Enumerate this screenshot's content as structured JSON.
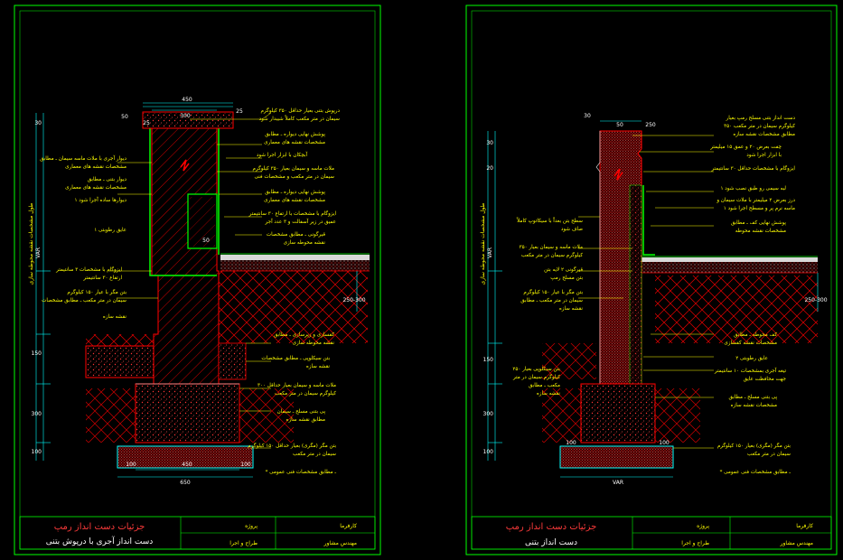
{
  "colors": {
    "background": "#000000",
    "frame": "#00ff00",
    "structure": "#ff0000",
    "dimension": "#00ffff",
    "annotation": "#ffff00",
    "label": "#ffffff",
    "title": "#ff3b3b"
  },
  "sheet_left": {
    "title_block": {
      "main_title": "جزئیات دست انداز رمپ",
      "subtitle": "دست انداز آجری با درپوش بتنی",
      "field_1": "پروژه",
      "field_2": "کارفرما",
      "field_3": "طراح و اجرا",
      "field_4": "مهندس مشاور"
    },
    "dimensions_top": [
      "450",
      "25",
      "300",
      "25",
      "50",
      "50"
    ],
    "dimensions_left": [
      "30",
      "VAR",
      "150",
      "300",
      "100"
    ],
    "dimensions_bottom": [
      "100",
      "450",
      "100",
      "650"
    ],
    "dimensions_right": [
      "250-300"
    ],
    "labels_right": [
      "درپوش بتنی بعیار حداقل ۳۵۰ کیلوگرم",
      "سیمان در متر مکعب کاملاً شیبدار شود",
      "پوشش نهایی دیواره ـ مطابق",
      "مشخصات نقشه های معماری",
      "آبچکان با ابزار اجرا شود",
      "ملات ماسه و سیمان بعیار ۳۵۰ کیلوگرم",
      "سیمان در متر مکعب و مشخصات فنی",
      "پوشش نهایی دیواره ـ مطابق",
      "مشخصات نقشه های معماری",
      "ایزوگام با مشخصات با ارتفاع ۳۰ سانتیمتر",
      "عمیق در زیر آسفالت و ۳ عدد آجر",
      "قیرگونی ـ مطابق مشخصات",
      "نقشه محوطه سازی"
    ],
    "labels_left": [
      "دیوار آجری با ملات ماسه سیمان ـ مطابق",
      "مشخصات نقشه های معماری",
      "دیوار بتنی ـ مطابق",
      "مشخصات نقشه های معماری",
      "دیوارها ساده آجرا شود ۱",
      "عایق رطوبتی ۱",
      "ایزوگام با مشخصات ۳ سانتیمتر",
      "ارتفاع ۳۰ سانتیمتر",
      "بتن مگر با عیار ۱۵۰ کیلوگرم",
      "سیمان در متر مکعب ـ مطابق مشخصات",
      "نقشه سازه"
    ],
    "labels_right_lower": [
      "کفسازی و زیرسازی ـ مطابق",
      "نقشه محوطه سازی",
      "بتن سیکلوپی ـ مطابق مشخصات",
      "نقشه سازه",
      "ملات ماسه و سیمان بعیار حداقل ۳۰۰",
      "کیلوگرم سیمان در متر مکعب",
      "پی بتنی مسلح ـ سیمان",
      "مطابق نقشه سازه",
      "بتن مگر (مگری) بعیار حداقل ۱۵۰ کیلوگرم",
      "سیمان در متر مکعب",
      "* ـ مطابق مشخصات فنی عمومی"
    ],
    "vertical_label": "طول مشخصات نقشه محوطه سازی"
  },
  "sheet_right": {
    "title_block": {
      "main_title": "جزئیات دست انداز رمپ",
      "subtitle": "دست انداز بتنی",
      "field_1": "پروژه",
      "field_2": "کارفرما",
      "field_3": "طراح و اجرا",
      "field_4": "مهندس مشاور"
    },
    "dimensions_top": [
      "30",
      "50",
      "250"
    ],
    "dimensions_left": [
      "30",
      "20",
      "VAR",
      "150",
      "300",
      "100"
    ],
    "dimensions_bottom": [
      "100",
      "VAR",
      "100"
    ],
    "dimensions_right": [
      "250-300"
    ],
    "labels_right": [
      "دست انداز بتنی مسلح رمپ بعیار",
      "۳۵۰ کیلوگرم سیمان در متر مکعب",
      "مطابق مشخصات نقشه سازه",
      "چفت بعرض ۲۰ و عمق ۱۵ میلیمتر",
      "با ابزار اجرا شود",
      "ایزوگام با مشخصات حداقل ۳۰ سانتیمتر",
      "لبه سیمی رو طبق نصب شود ۱",
      "درز بعرض ۲ میلیمتر با ملات سیمان و",
      "ماسه نرم پر و مسطح اجرا شود ۱",
      "پوشش نهایی کف ـ مطابق",
      "مشخصات نقشه محوطه"
    ],
    "labels_left": [
      "سطح بتن بعداً با سیکاتوپ کاملاً",
      "صاف شود",
      "ملات ماسه و سیمان بعیار ۳۵۰",
      "کیلوگرم سیمان در متر مکعب",
      "قیرگونی ۲ لایه بتن",
      "بتن مسلح رمپ",
      "بتن مگر با عیار ۱۵۰ کیلوگرم",
      "سیمان در متر مکعب ـ مطابق",
      "نقشه سازه",
      "بتن سیکلوپی بعیار ۲۵۰",
      "کیلوگرم سیمان در متر",
      "مکعب ـ مطابق",
      "نقشه سازه"
    ],
    "labels_right_lower": [
      "کف محوطه ـ مطابق",
      "مشخصات نقشه کفسازی",
      "عایق رطوبتی ۲",
      "تیغه آجری بمشخصات ۱۰ سانتیمتر",
      "جهت محافظت عایق",
      "پی بتنی مسلح ـ مطابق",
      "مشخصات نقشه سازه",
      "بتن مگر (مگری) بعیار ۱۵۰ کیلوگرم",
      "سیمان در متر مکعب",
      "* ـ مطابق مشخصات فنی عمومی"
    ],
    "vertical_label": "طول مشخصات نقشه محوطه سازی"
  }
}
